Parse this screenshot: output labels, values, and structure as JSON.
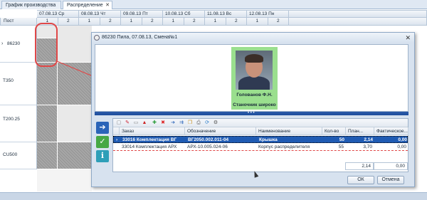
{
  "tabs": [
    {
      "label": "График производства",
      "active": false
    },
    {
      "label": "Распределение работ",
      "active": true
    }
  ],
  "dates": [
    "07.08.13 Ср",
    "08.08.13 Чт",
    "09.08.13 Пт",
    "10.08.13 Сб",
    "11.08.13 Вс",
    "12.08.13 Пн"
  ],
  "post_header": "Пост",
  "shifts": [
    "1",
    "2"
  ],
  "posts": [
    {
      "label": "86230",
      "selected": true
    },
    {
      "label": "T350",
      "selected": false
    },
    {
      "label": "T200.25",
      "selected": false
    },
    {
      "label": "CU500",
      "selected": false
    }
  ],
  "dialog": {
    "title": "86230 Пила, 07.08.13, Смена№1",
    "employee_name": "Голованов Ф.Н.",
    "employee_role": "Станочник широко",
    "columns": [
      "Заказ",
      "Обозначение",
      "Наименование",
      "Кол-во",
      "План...",
      "Фактическое..."
    ],
    "rows": [
      {
        "order": "33016 Комплектация ВГ",
        "code": "ВГ2050.002.011-04",
        "name": "Крышка",
        "qty": "50",
        "plan": "2,14",
        "fact": "0,00"
      },
      {
        "order": "33014 Комплектация АРХ",
        "code": "АРХ-10.005.024-06",
        "name": "Корпус распределителя",
        "qty": "55",
        "plan": "3,70",
        "fact": "0,00"
      }
    ],
    "totals": {
      "plan": "2,14",
      "fact": "0,00"
    },
    "ok_label": "ОК",
    "cancel_label": "Отмена"
  },
  "colors": {
    "accent": "#1f5bb3",
    "card": "#9adf8e",
    "highlight": "#e04848"
  }
}
